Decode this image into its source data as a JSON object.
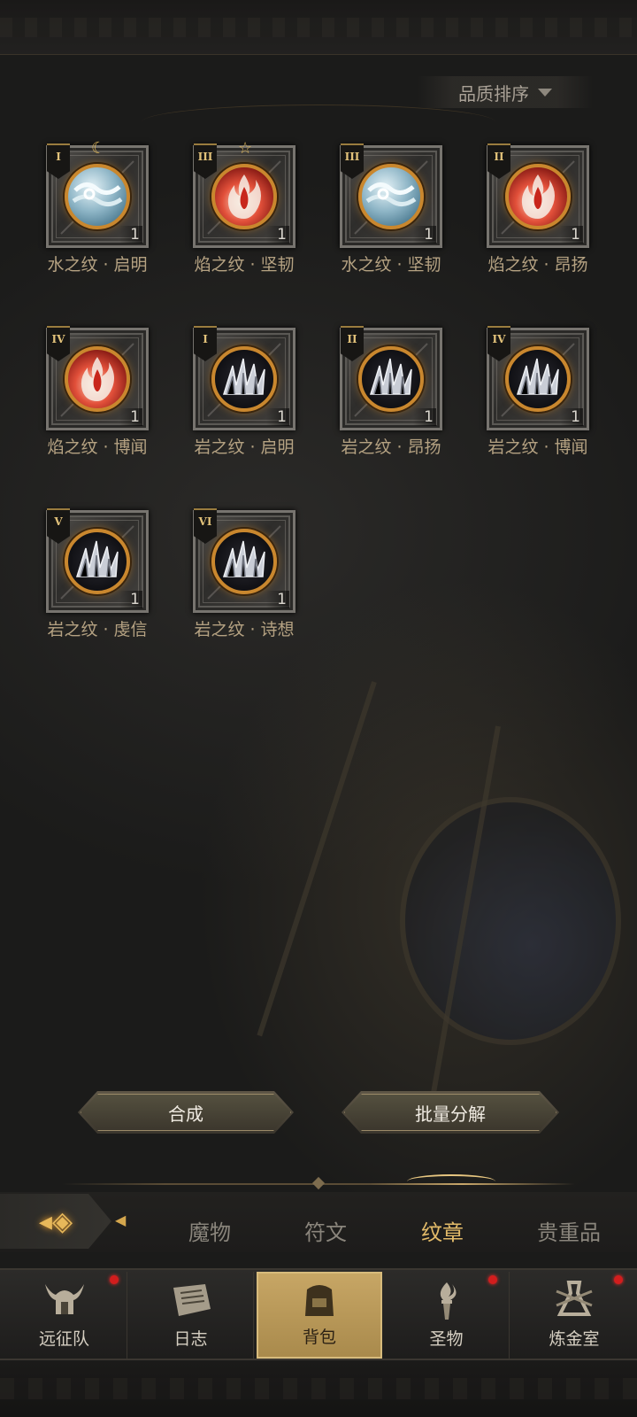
{
  "sort": {
    "label": "品质排序"
  },
  "items": [
    {
      "tier": "I",
      "element": "water",
      "name": "水之纹 · 启明",
      "count": "1",
      "ornament": "☾"
    },
    {
      "tier": "III",
      "element": "fire",
      "name": "焰之纹 · 坚韧",
      "count": "1",
      "ornament": "☆"
    },
    {
      "tier": "III",
      "element": "water",
      "name": "水之纹 · 坚韧",
      "count": "1",
      "ornament": ""
    },
    {
      "tier": "II",
      "element": "fire",
      "name": "焰之纹 · 昂扬",
      "count": "1",
      "ornament": ""
    },
    {
      "tier": "IV",
      "element": "fire",
      "name": "焰之纹 · 博闻",
      "count": "1",
      "ornament": ""
    },
    {
      "tier": "I",
      "element": "rock",
      "name": "岩之纹 · 启明",
      "count": "1",
      "ornament": ""
    },
    {
      "tier": "II",
      "element": "rock",
      "name": "岩之纹 · 昂扬",
      "count": "1",
      "ornament": ""
    },
    {
      "tier": "IV",
      "element": "rock",
      "name": "岩之纹 · 博闻",
      "count": "1",
      "ornament": ""
    },
    {
      "tier": "V",
      "element": "rock",
      "name": "岩之纹 · 虔信",
      "count": "1",
      "ornament": ""
    },
    {
      "tier": "VI",
      "element": "rock",
      "name": "岩之纹 · 诗想",
      "count": "1",
      "ornament": ""
    }
  ],
  "actions": {
    "merge": "合成",
    "decompose": "批量分解"
  },
  "tabs": [
    {
      "label": "魔物",
      "active": false
    },
    {
      "label": "符文",
      "active": false
    },
    {
      "label": "纹章",
      "active": true
    },
    {
      "label": "贵重品",
      "active": false
    }
  ],
  "nav": [
    {
      "label": "远征队",
      "icon": "viking-helmet-icon",
      "active": false,
      "badge": true
    },
    {
      "label": "日志",
      "icon": "scroll-icon",
      "active": false,
      "badge": false
    },
    {
      "label": "背包",
      "icon": "backpack-icon",
      "active": true,
      "badge": false
    },
    {
      "label": "圣物",
      "icon": "torch-icon",
      "active": false,
      "badge": true
    },
    {
      "label": "炼金室",
      "icon": "alchemy-icon",
      "active": false,
      "badge": true
    }
  ],
  "colors": {
    "accent_gold": "#e3bb69",
    "orb_ring": "#c9872e",
    "badge_red": "#d21d1d"
  }
}
